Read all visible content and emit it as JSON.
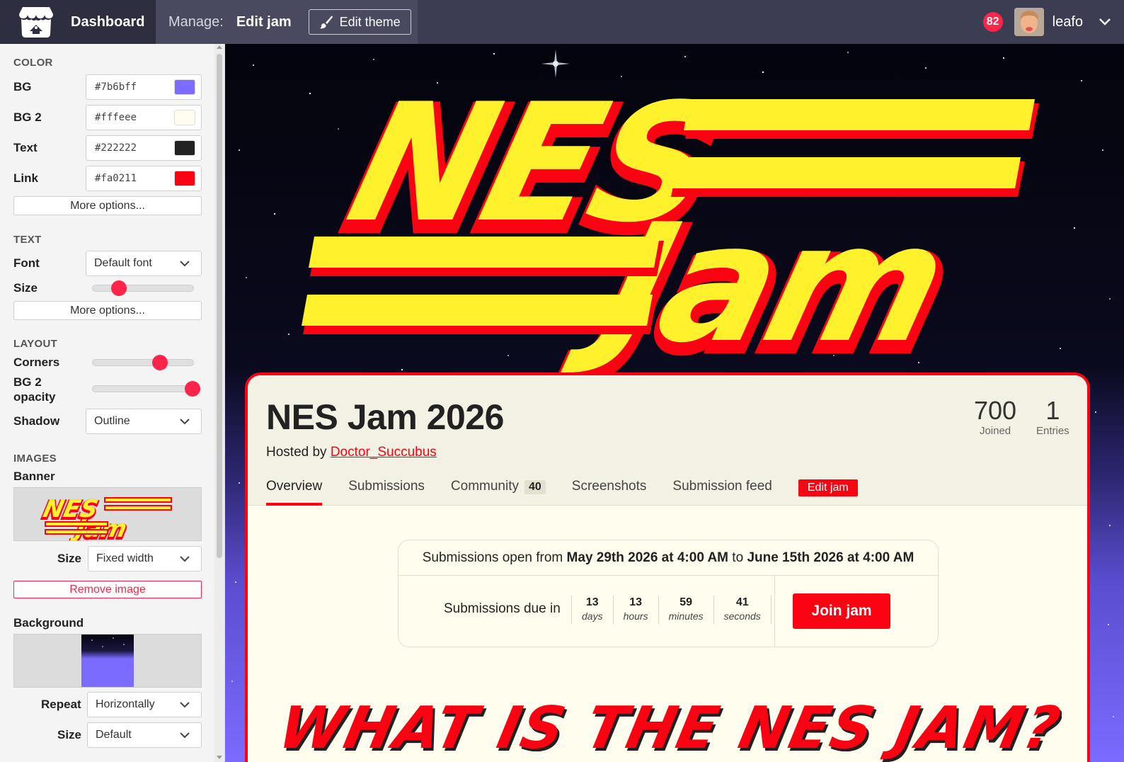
{
  "topbar": {
    "dashboard": "Dashboard",
    "manage_label": "Manage:",
    "manage_jam": "Edit jam",
    "edit_theme": "Edit theme",
    "notification_count": "82",
    "username": "leafo"
  },
  "sidebar": {
    "color_section": "COLOR",
    "colors": [
      {
        "label": "BG",
        "value": "#7b6bff",
        "swatch": "#7b6bff"
      },
      {
        "label": "BG 2",
        "value": "#fffeee",
        "swatch": "#fffeee"
      },
      {
        "label": "Text",
        "value": "#222222",
        "swatch": "#222222"
      },
      {
        "label": "Link",
        "value": "#fa0211",
        "swatch": "#fa0211"
      }
    ],
    "more_options": "More options...",
    "text_section": "TEXT",
    "font_label": "Font",
    "font_value": "Default font",
    "size_label": "Size",
    "size_level": 0.25,
    "layout_section": "LAYOUT",
    "corners_label": "Corners",
    "corners_level": 0.66,
    "bg2_opacity_label_1": "BG 2",
    "bg2_opacity_label_2": "opacity",
    "bg2_opacity_level": 1.0,
    "shadow_label": "Shadow",
    "shadow_value": "Outline",
    "images_section": "IMAGES",
    "banner_label": "Banner",
    "banner_size_label": "Size",
    "banner_size_value": "Fixed width",
    "remove_image": "Remove image",
    "background_label": "Background",
    "repeat_label": "Repeat",
    "repeat_value": "Horizontally",
    "bg_size_label": "Size",
    "bg_size_value": "Default"
  },
  "jam": {
    "title": "NES Jam 2026",
    "hosted_by": "Hosted by",
    "host": "Doctor_Succubus",
    "joined_count": "700",
    "joined_label": "Joined",
    "entries_count": "1",
    "entries_label": "Entries",
    "tabs": [
      {
        "label": "Overview",
        "active": true
      },
      {
        "label": "Submissions"
      },
      {
        "label": "Community",
        "count": "40"
      },
      {
        "label": "Screenshots"
      },
      {
        "label": "Submission feed"
      }
    ],
    "edit_jam": "Edit jam",
    "open_prefix": "Submissions open from",
    "open_start": "May 29th 2026 at 4:00 AM",
    "open_to": "to",
    "open_end": "June 15th 2026 at 4:00 AM",
    "due_in": "Submissions due in",
    "countdown": [
      {
        "num": "13",
        "unit": "days"
      },
      {
        "num": "13",
        "unit": "hours"
      },
      {
        "num": "59",
        "unit": "minutes"
      },
      {
        "num": "41",
        "unit": "seconds"
      }
    ],
    "join": "Join jam"
  },
  "banner": {
    "line1": "NES",
    "line2": "Jam",
    "heading": "WHAT IS THE NES JAM?"
  },
  "colors": {
    "accent": "#fa0211",
    "badge": "#ff2449",
    "banner_yellow": "#fff22c",
    "bg": "#7b6bff"
  }
}
